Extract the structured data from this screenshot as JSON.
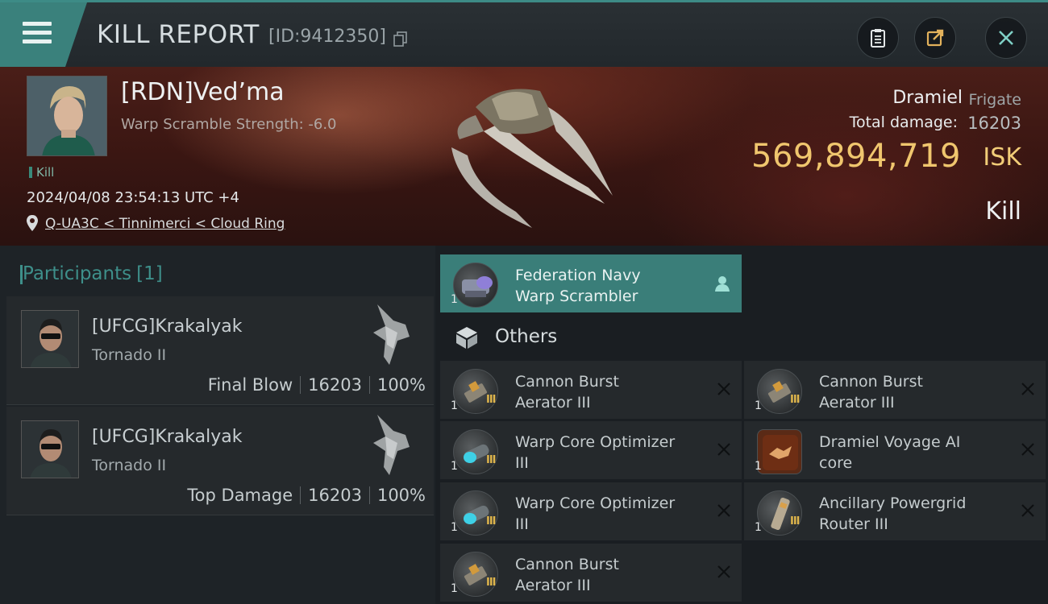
{
  "header": {
    "title": "KILL REPORT",
    "id_text": "[ID:9412350]"
  },
  "victim": {
    "pilot_name": "[RDN]Ved’ma",
    "warp_scramble_strength": "Warp Scramble Strength: -6.0",
    "kill_tag": "Kill",
    "timestamp": "2024/04/08 23:54:13 UTC +4",
    "location": "Q-UA3C < Tinnimerci < Cloud Ring",
    "ship_name": "Dramiel",
    "ship_class": "Frigate",
    "total_damage_label": "Total damage:",
    "total_damage_value": "16203",
    "isk_value": "569,894,719",
    "isk_unit": "ISK",
    "result_label": "Kill"
  },
  "participants": {
    "heading": "Participants",
    "count": "[1]",
    "rows": [
      {
        "name": "[UFCG]Krakalyak",
        "ship": "Tornado II",
        "role": "Final Blow",
        "damage": "16203",
        "percent": "100%"
      },
      {
        "name": "[UFCG]Krakalyak",
        "ship": "Tornado II",
        "role": "Top Damage",
        "damage": "16203",
        "percent": "100%"
      }
    ]
  },
  "fitted_item": {
    "name_line1": "Federation Navy",
    "name_line2": "Warp Scrambler",
    "qty": "1"
  },
  "others": {
    "heading": "Others",
    "items": [
      {
        "line1": "Cannon Burst",
        "line2": "Aerator III",
        "qty": "1",
        "tier": "III"
      },
      {
        "line1": "Cannon Burst",
        "line2": "Aerator III",
        "qty": "1",
        "tier": "III"
      },
      {
        "line1": "Warp Core Optimizer",
        "line2": "III",
        "qty": "1",
        "tier": "III"
      },
      {
        "line1": "Dramiel Voyage AI",
        "line2": "core",
        "qty": "1",
        "tier": ""
      },
      {
        "line1": "Warp Core Optimizer",
        "line2": "III",
        "qty": "1",
        "tier": "III"
      },
      {
        "line1": "Ancillary Powergrid",
        "line2": "Router III",
        "qty": "1",
        "tier": "III"
      },
      {
        "line1": "Cannon Burst",
        "line2": "Aerator III",
        "qty": "1",
        "tier": "III"
      }
    ]
  },
  "colors": {
    "accent_teal": "#3a817c",
    "isk_gold": "#f0c66e",
    "tier_gold": "#e0b64c"
  }
}
